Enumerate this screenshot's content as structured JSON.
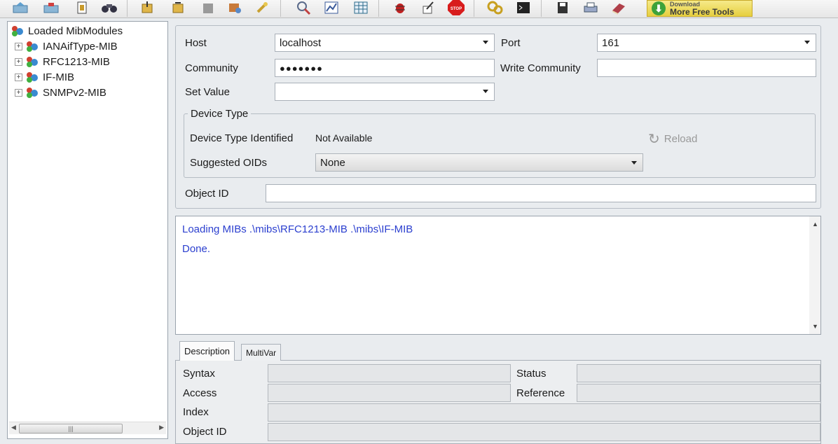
{
  "toolbar": {
    "icons": [
      "load-mib-icon",
      "unload-mib-icon",
      "mib-info-icon",
      "find-icon",
      "get-icon",
      "getnext-icon",
      "getbulk-icon",
      "set-icon",
      "trap-icon",
      "search-icon",
      "graph-icon",
      "table-icon",
      "debug-icon",
      "edit-icon",
      "stop-icon",
      "tools-icon",
      "terminal-icon",
      "save-icon",
      "print-icon",
      "book-icon"
    ],
    "download": {
      "top_text": "Download",
      "label": "More Free Tools"
    }
  },
  "tree": {
    "root_label": "Loaded MibModules",
    "modules": [
      "IANAifType-MIB",
      "RFC1213-MIB",
      "IF-MIB",
      "SNMPv2-MIB"
    ]
  },
  "form": {
    "host_label": "Host",
    "host_value": "localhost",
    "port_label": "Port",
    "port_value": "161",
    "community_label": "Community",
    "community_value": "●●●●●●●",
    "write_community_label": "Write Community",
    "write_community_value": "",
    "set_value_label": "Set Value",
    "set_value_value": "",
    "device_type_title": "Device Type",
    "device_type_identified_label": "Device Type Identified",
    "device_type_identified_value": "Not Available",
    "reload_label": "Reload",
    "suggested_oids_label": "Suggested OIDs",
    "suggested_oids_value": "None",
    "object_id_label": "Object ID",
    "object_id_value": ""
  },
  "log": {
    "lines": [
      "Loading MIBs .\\mibs\\RFC1213-MIB .\\mibs\\IF-MIB",
      "Done."
    ]
  },
  "bottom": {
    "tabs": [
      "Description",
      "MultiVar"
    ],
    "syntax_label": "Syntax",
    "status_label": "Status",
    "access_label": "Access",
    "reference_label": "Reference",
    "index_label": "Index",
    "object_id_label": "Object ID"
  },
  "colors": {
    "log_text": "#2b3fcf",
    "background": "#e9ecef",
    "download_bg": "#e6cf3f"
  }
}
